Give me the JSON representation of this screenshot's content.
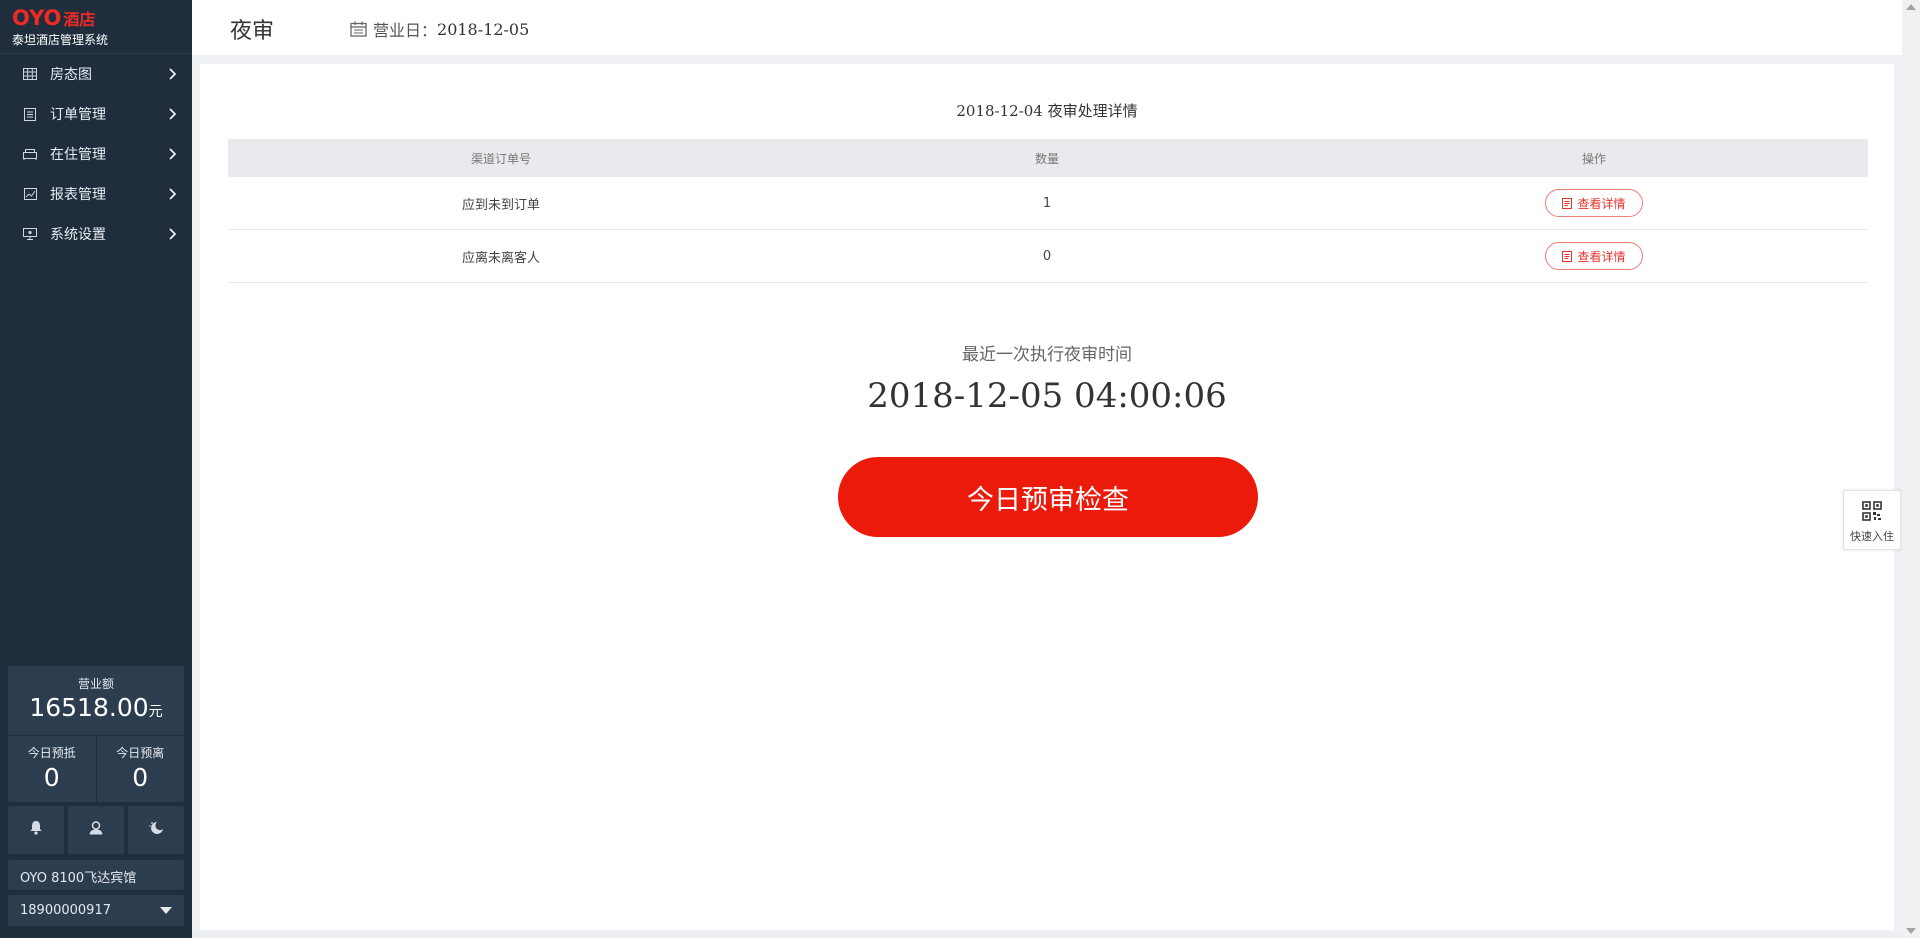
{
  "brand": {
    "logo_text": "OYO",
    "logo_suffix": "酒店",
    "system_name": "泰坦酒店管理系统",
    "accent_color": "#ee2a24"
  },
  "sidebar": {
    "items": [
      {
        "label": "房态图",
        "icon": "grid-icon"
      },
      {
        "label": "订单管理",
        "icon": "order-list-icon"
      },
      {
        "label": "在住管理",
        "icon": "bed-icon"
      },
      {
        "label": "报表管理",
        "icon": "chart-icon"
      },
      {
        "label": "系统设置",
        "icon": "monitor-settings-icon"
      }
    ],
    "revenue_label": "营业额",
    "revenue_value": "16518.00",
    "revenue_unit": "元",
    "arrival_label": "今日预抵",
    "arrival_value": "0",
    "departure_label": "今日预离",
    "departure_value": "0",
    "action_icons": [
      "bell-icon",
      "user-icon",
      "night-audit-moon-icon"
    ],
    "hotel_name": "OYO 8100飞达宾馆",
    "account": "18900000917"
  },
  "header": {
    "title": "夜审",
    "business_date_label": "营业日：",
    "business_date": "2018-12-05"
  },
  "main": {
    "section_title": "2018-12-04 夜审处理详情",
    "table": {
      "columns": [
        "渠道订单号",
        "数量",
        "操作"
      ],
      "rows": [
        {
          "name": "应到未到订单",
          "count": "1",
          "action": "查看详情"
        },
        {
          "name": "应离未离客人",
          "count": "0",
          "action": "查看详情"
        }
      ]
    },
    "last_exec_label": "最近一次执行夜审时间",
    "last_exec_time": "2018-12-05 04:00:06",
    "check_button": "今日预审检查",
    "check_button_color": "#ec1a0b"
  },
  "quick_checkin": {
    "label": "快速入住",
    "icon": "qr-code-icon"
  }
}
